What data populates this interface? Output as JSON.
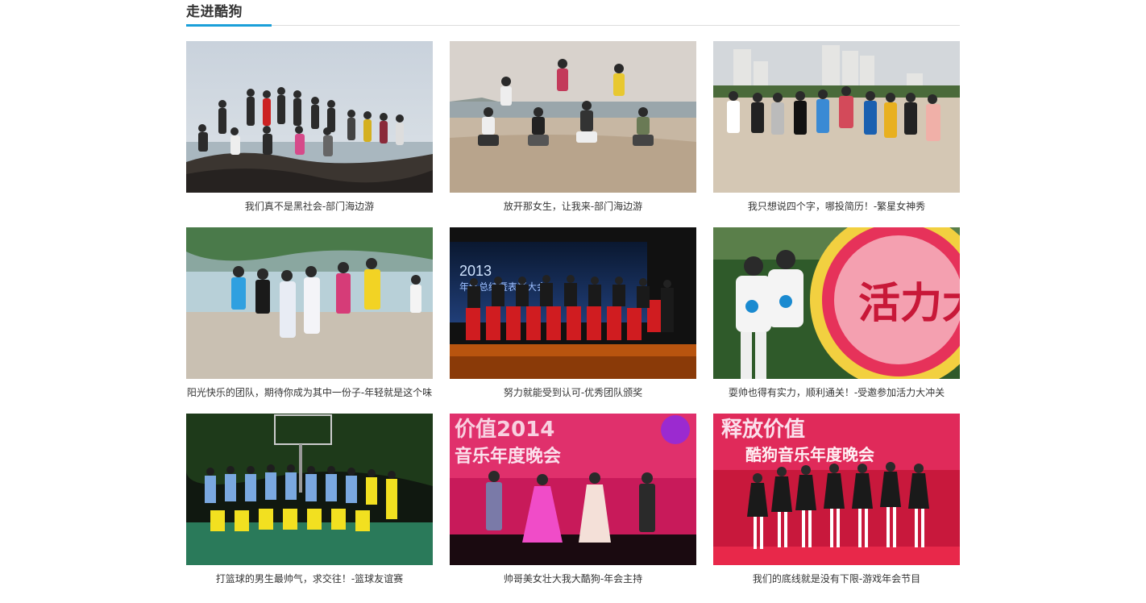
{
  "section": {
    "title": "走进酷狗",
    "accent_color": "#1a9fd9"
  },
  "gallery": [
    {
      "caption": "我们真不是黑社会-部门海边游"
    },
    {
      "caption": "放开那女生，让我来-部门海边游"
    },
    {
      "caption": "我只想说四个字，哪投简历！-繁星女神秀"
    },
    {
      "caption": "阳光快乐的团队，期待你成为其中一份子-年轻就是这个味"
    },
    {
      "caption": "努力就能受到认可-优秀团队颁奖"
    },
    {
      "caption": "耍帅也得有实力，顺利通关！-受邀参加活力大冲关"
    },
    {
      "caption": "打篮球的男生最帅气，求交往！-篮球友谊赛"
    },
    {
      "caption": "帅哥美女壮大我大酷狗-年会主持"
    },
    {
      "caption": "我们的底线就是没有下限-游戏年会节目"
    }
  ],
  "photo_text": {
    "stage_banner_year": "2013",
    "stage_banner_text": "年终总结暨表彰大会",
    "game_logo_text": "活力大冲关",
    "night_banner_1": "价值2014",
    "night_banner_1_sub": "音乐年度晚会",
    "night_banner_2": "释放价值",
    "night_banner_2_sub": "酷狗音乐年度晚会"
  }
}
